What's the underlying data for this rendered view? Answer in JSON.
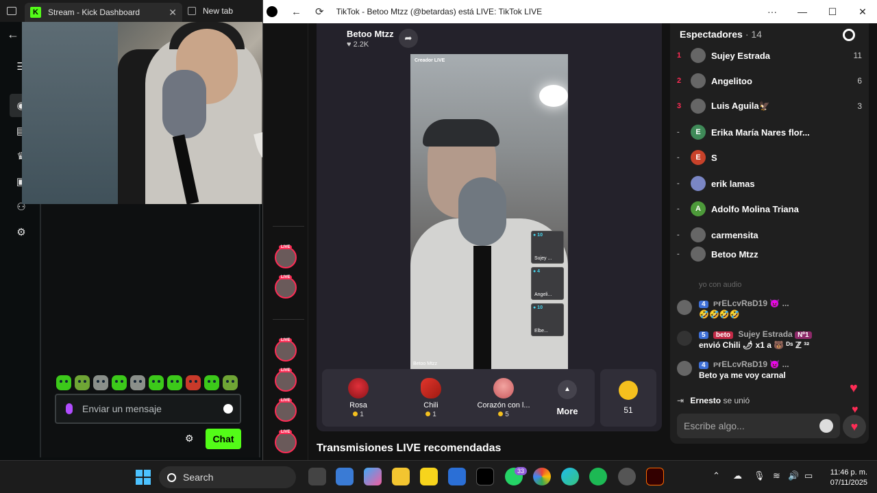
{
  "kick": {
    "tab_title": "Stream - Kick Dashboard",
    "newtab_title": "New tab",
    "tab_close": "✕",
    "back_arrow": "←",
    "sidebar_icons": [
      "menu-icon",
      "broadcast-icon",
      "analytics-icon",
      "trophy-icon",
      "screen-icon",
      "users-icon",
      "settings-icon"
    ],
    "message_placeholder": "Enviar un mensaje",
    "chat_button": "Chat",
    "accent": "#53fc18"
  },
  "tiktok": {
    "window_title": "TikTok - Betoo Mtzz (@betardas) está LIVE: TikTok LIVE",
    "menu_dots": "···",
    "minimize": "—",
    "maximize": "☐",
    "close": "✕",
    "streamer_name": "Betoo Mtzz",
    "streamer_likes": "♥ 2.2K",
    "video_label_top": "Creador LIVE",
    "video_label_bottom": "Betoo Mtzz",
    "guests": [
      {
        "coins": "● 10",
        "name": "Sujey ..."
      },
      {
        "coins": "● 4",
        "name": "Angeli..."
      },
      {
        "coins": "● 10",
        "name": "Elbe..."
      }
    ],
    "gifts": [
      {
        "name": "Rosa",
        "price": "1"
      },
      {
        "name": "Chili",
        "price": "1"
      },
      {
        "name": "Corazón con l...",
        "price": "5"
      }
    ],
    "more_label": "More",
    "coin_balance": "51",
    "live_badge": "LIVE",
    "recommended": "Transmisiones LIVE recomendadas",
    "brand_color": "#fe2c55"
  },
  "viewers": {
    "heading": "Espectadores",
    "count": "· 14",
    "list": [
      {
        "rank": "1",
        "name": "Sujey Estrada",
        "score": "11",
        "initial": ""
      },
      {
        "rank": "2",
        "name": "Angelitoo",
        "score": "6",
        "initial": ""
      },
      {
        "rank": "3",
        "name": "Luis Aguila🦅",
        "score": "3",
        "initial": ""
      },
      {
        "rank": "-",
        "name": "Erika María Nares flor...",
        "score": "",
        "initial": "E"
      },
      {
        "rank": "-",
        "name": "S",
        "score": "",
        "initial": "E"
      },
      {
        "rank": "-",
        "name": "erik lamas",
        "score": "",
        "initial": ""
      },
      {
        "rank": "-",
        "name": "Adolfo Molina Triana",
        "score": "",
        "initial": "A"
      },
      {
        "rank": "-",
        "name": "carmensita",
        "score": "",
        "initial": ""
      },
      {
        "rank": "-",
        "name": "Betoo Mtzz",
        "score": "",
        "initial": ""
      }
    ]
  },
  "chat": {
    "faded_text": "yo con audio",
    "messages": [
      {
        "level": "4",
        "name": "ᴘғELᴄᴠRвD19 👿 ...",
        "text": "🤣🤣🤣🤣",
        "fan_badge": "",
        "rank_badge": ""
      },
      {
        "level": "5",
        "name": "Sujey Estrada",
        "text": "envió Chili 🌶 x1 a 🐻 ᴰˢ ℤ ³²",
        "fan_badge": "beto",
        "rank_badge": "Nº1"
      },
      {
        "level": "4",
        "name": "ᴘғELᴄᴠRвD19 👿 ...",
        "text": "Beto ya me voy carnal",
        "fan_badge": "",
        "rank_badge": ""
      }
    ],
    "joined_name": "Ernesto",
    "joined_text": "se unió",
    "comment_placeholder": "Escribe algo...",
    "heart": "♥"
  },
  "taskbar": {
    "search": "Search",
    "whatsapp_badge": "33",
    "clock_time": "11:46 p. m.",
    "clock_date": "07/11/2025"
  }
}
